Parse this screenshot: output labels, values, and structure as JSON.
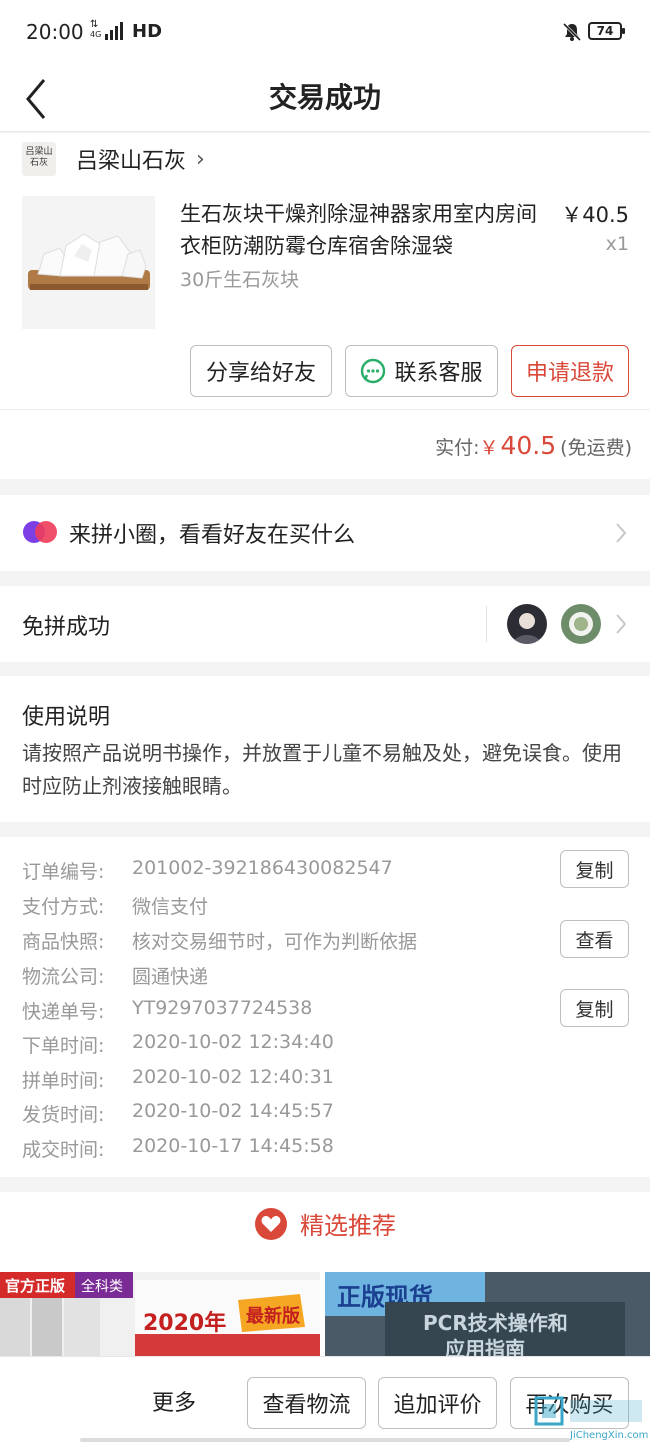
{
  "status": {
    "time": "20:00",
    "network": "4G",
    "hd": "HD",
    "battery": "74"
  },
  "header": {
    "title": "交易成功"
  },
  "shop": {
    "logo_text_line1": "吕梁山",
    "logo_text_line2": "石灰",
    "name": "吕梁山石灰"
  },
  "product": {
    "title": "生石灰块干燥剂除湿神器家用室内房间衣柜防潮防霉仓库宿舍除湿袋",
    "spec": "30斤生石灰块",
    "price": "￥40.5",
    "qty": "x1"
  },
  "actions": {
    "share": "分享给好友",
    "service": "联系客服",
    "refund": "申请退款"
  },
  "payment": {
    "label": "实付:",
    "currency": "￥",
    "amount": "40.5",
    "note": "(免运费)"
  },
  "circle": {
    "text": "来拼小圈，看看好友在买什么"
  },
  "group": {
    "text": "免拼成功"
  },
  "usage": {
    "title": "使用说明",
    "text": "请按照产品说明书操作，并放置于儿童不易触及处，避免误食。使用时应防止剂液接触眼睛。"
  },
  "order": {
    "rows": [
      {
        "k": "订单编号:",
        "v": "201002-392186430082547",
        "btn": "复制"
      },
      {
        "k": "支付方式:",
        "v": "微信支付"
      },
      {
        "k": "商品快照:",
        "v": "核对交易细节时，可作为判断依据",
        "btn": "查看"
      },
      {
        "k": "物流公司:",
        "v": "圆通快递"
      },
      {
        "k": "快递单号:",
        "v": "YT9297037724538",
        "btn": "复制"
      },
      {
        "k": "下单时间:",
        "v": "2020-10-02 12:34:40"
      },
      {
        "k": "拼单时间:",
        "v": "2020-10-02 12:40:31"
      },
      {
        "k": "发货时间:",
        "v": "2020-10-02 14:45:57"
      },
      {
        "k": "成交时间:",
        "v": "2020-10-17 14:45:58"
      }
    ]
  },
  "recommend": {
    "title": "精选推荐",
    "item1": {
      "badge1": "官方正版",
      "badge2": "全科类",
      "year": "2020年",
      "tag": "最新版"
    },
    "item2": {
      "banner": "正版现货",
      "book_line1": "PCR技术操作和",
      "book_line2": "应用指南"
    }
  },
  "bottom": {
    "more": "更多",
    "logistics": "查看物流",
    "review": "追加评价",
    "rebuy": "再次购买"
  },
  "watermark": {
    "site": "JiChengXin.com"
  },
  "colors": {
    "accent": "#d94838",
    "text": "#222222",
    "muted": "#999999"
  }
}
